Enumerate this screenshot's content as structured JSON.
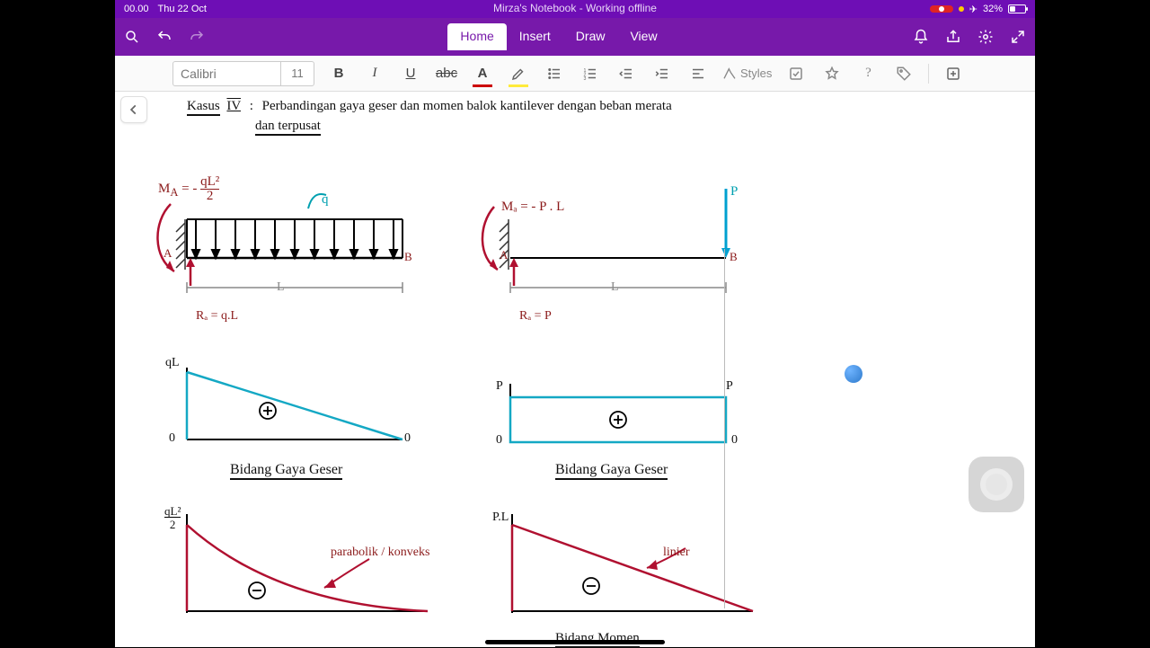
{
  "statusbar": {
    "time": "00.00",
    "date": "Thu 22 Oct",
    "title": "Mirza's Notebook - Working offline",
    "battery_pct": "32%"
  },
  "tabs": {
    "home": "Home",
    "insert": "Insert",
    "draw": "Draw",
    "view": "View"
  },
  "ribbon": {
    "font_name": "Calibri",
    "font_size": "11",
    "bold": "B",
    "italic": "I",
    "underline": "U",
    "strike": "abc",
    "fontcolor": "A",
    "highlight": "A",
    "styles": "Styles"
  },
  "notes": {
    "kasus_label": "Kasus",
    "kasus_num": "IV",
    "kasus_colon": ":",
    "title_line1": "Perbandingan gaya geser dan momen balok kantilever dengan beban merata",
    "title_line2": "dan terpusat",
    "MA_left": "Mₐ = - qL² / 2",
    "q_label": "q",
    "A": "A",
    "B": "B",
    "L": "L",
    "RA_left": "Rₐ = q.L",
    "MA_right": "Mₐ = - P . L",
    "P": "P",
    "RA_right": "Rₐ = P",
    "qL": "qL",
    "zero": "0",
    "bgg": "Bidang Gaya Geser",
    "qL2": "qL²",
    "qL2_2": "2",
    "parabolik": "parabolik / konveks",
    "PL": "P.L",
    "linier": "linier",
    "bm": "Bidang Momen",
    "plus": "+",
    "minus": "–"
  }
}
